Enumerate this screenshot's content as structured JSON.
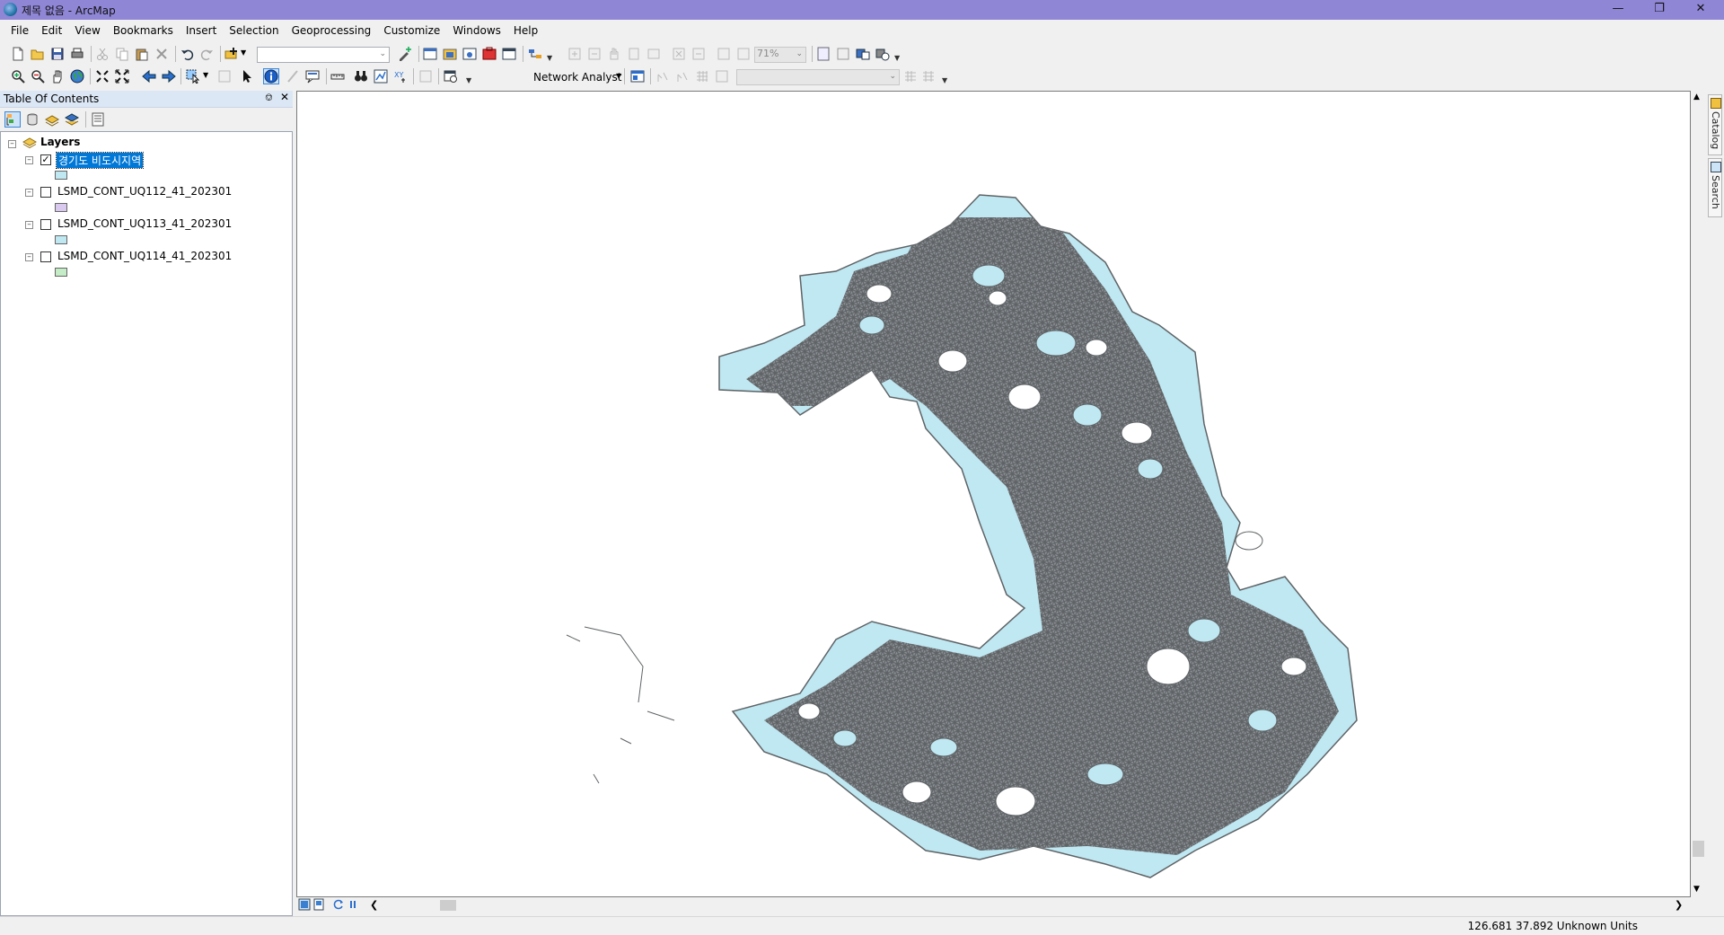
{
  "window": {
    "title": "제목 없음 - ArcMap"
  },
  "menu": [
    "File",
    "Edit",
    "View",
    "Bookmarks",
    "Insert",
    "Selection",
    "Geoprocessing",
    "Customize",
    "Windows",
    "Help"
  ],
  "toolbar": {
    "scale_value": "",
    "zoom_level": "71%",
    "network_analyst_label": "Network Analyst",
    "network_layer_value": ""
  },
  "toc": {
    "title": "Table Of Contents",
    "root": "Layers",
    "layers": [
      {
        "name": "경기도 비도시지역",
        "checked": true,
        "selected": true,
        "color": "#bfe8f2"
      },
      {
        "name": "LSMD_CONT_UQ112_41_202301",
        "checked": false,
        "selected": false,
        "color": "#d9c9ee"
      },
      {
        "name": "LSMD_CONT_UQ113_41_202301",
        "checked": false,
        "selected": false,
        "color": "#bfe8f2"
      },
      {
        "name": "LSMD_CONT_UQ114_41_202301",
        "checked": false,
        "selected": false,
        "color": "#c4ecc6"
      }
    ]
  },
  "dock": {
    "catalog": "Catalog",
    "search": "Search"
  },
  "status": {
    "coordinates": "126.681  37.892 Unknown Units"
  },
  "colors": {
    "map_fill": "#bfe8f2",
    "map_line": "#666666",
    "title_bar": "#8f86d6",
    "selection": "#0078d7"
  }
}
